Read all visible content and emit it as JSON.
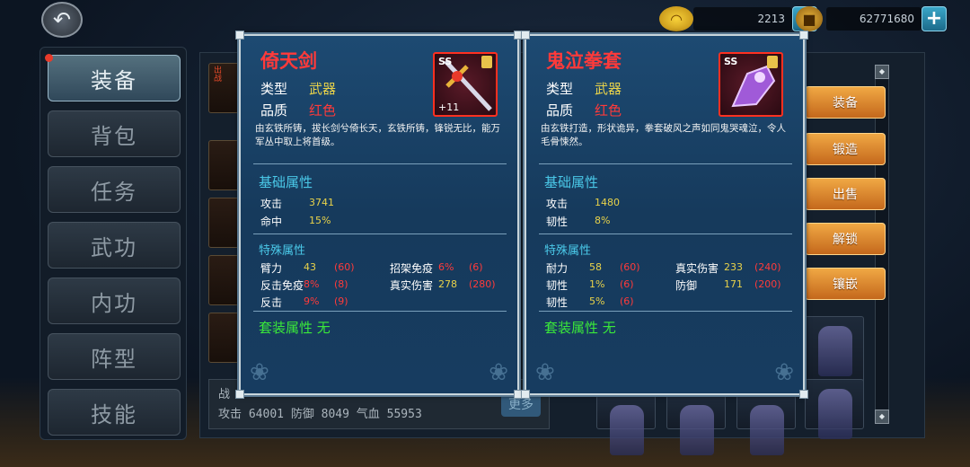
{
  "currencies": [
    {
      "icon": "gold-ingot-icon",
      "value": "2213"
    },
    {
      "icon": "copper-coin-icon",
      "value": "62771680"
    }
  ],
  "nav": {
    "items": [
      "装备",
      "背包",
      "任务",
      "武功",
      "内功",
      "阵型",
      "技能"
    ],
    "active": "装备"
  },
  "stats_bar": {
    "line1": "战",
    "line2_label_attack": "攻击",
    "attack": "64001",
    "line2_label_defense": "防御",
    "defense": "8049",
    "line2_label_hp": "气血",
    "hp": "55953",
    "more": "更多"
  },
  "left_slot_text": {
    "chuzhan": "出战"
  },
  "actions": [
    "装备",
    "锻造",
    "出售",
    "解锁",
    "镶嵌"
  ],
  "cards": [
    {
      "name": "倚天剑",
      "type_label": "类型",
      "type_value": "武器",
      "quality_label": "品质",
      "quality_value": "红色",
      "rank": "SS",
      "level": "+11",
      "icon": "sword-icon",
      "description": "由玄铁所铸，拔长剑兮倚长天，玄铁所铸，锋锐无比，能万军丛中取上将首级。",
      "base_title": "基础属性",
      "base": [
        {
          "name": "攻击",
          "value": "3741"
        },
        {
          "name": "命中",
          "value": "15%"
        }
      ],
      "special_title": "特殊属性",
      "special": [
        {
          "name": "臂力",
          "value": "43",
          "max": "(60)",
          "value_red": false
        },
        {
          "name": "招架免疫",
          "value": "6%",
          "max": "(6)",
          "value_red": true
        },
        {
          "name": "反击免疫",
          "value": "8%",
          "max": "(8)",
          "value_red": true
        },
        {
          "name": "真实伤害",
          "value": "278",
          "max": "(280)",
          "value_red": false
        },
        {
          "name": "反击",
          "value": "9%",
          "max": "(9)",
          "value_red": true
        }
      ],
      "suit": "套装属性 无"
    },
    {
      "name": "鬼泣拳套",
      "type_label": "类型",
      "type_value": "武器",
      "quality_label": "品质",
      "quality_value": "红色",
      "rank": "SS",
      "icon": "gauntlet-icon",
      "description": "由玄铁打造，形状诡异，拳套破风之声如同鬼哭魂泣，令人毛骨悚然。",
      "base_title": "基础属性",
      "base": [
        {
          "name": "攻击",
          "value": "1480"
        },
        {
          "name": "韧性",
          "value": "8%"
        }
      ],
      "special_title": "特殊属性",
      "special": [
        {
          "name": "耐力",
          "value": "58",
          "max": "(60)",
          "value_red": false
        },
        {
          "name": "真实伤害",
          "value": "233",
          "max": "(240)",
          "value_red": false
        },
        {
          "name": "韧性",
          "value": "1%",
          "max": "(6)",
          "value_red": false
        },
        {
          "name": "防御",
          "value": "171",
          "max": "(200)",
          "value_red": false
        },
        {
          "name": "韧性",
          "value": "5%",
          "max": "(6)",
          "value_red": false
        }
      ],
      "suit": "套装属性 无"
    }
  ],
  "colors": {
    "quality_red": "#ff3a3a",
    "value_yellow": "#e8d24a",
    "section_cyan": "#4ac8e8",
    "suit_green": "#3ae83a"
  }
}
